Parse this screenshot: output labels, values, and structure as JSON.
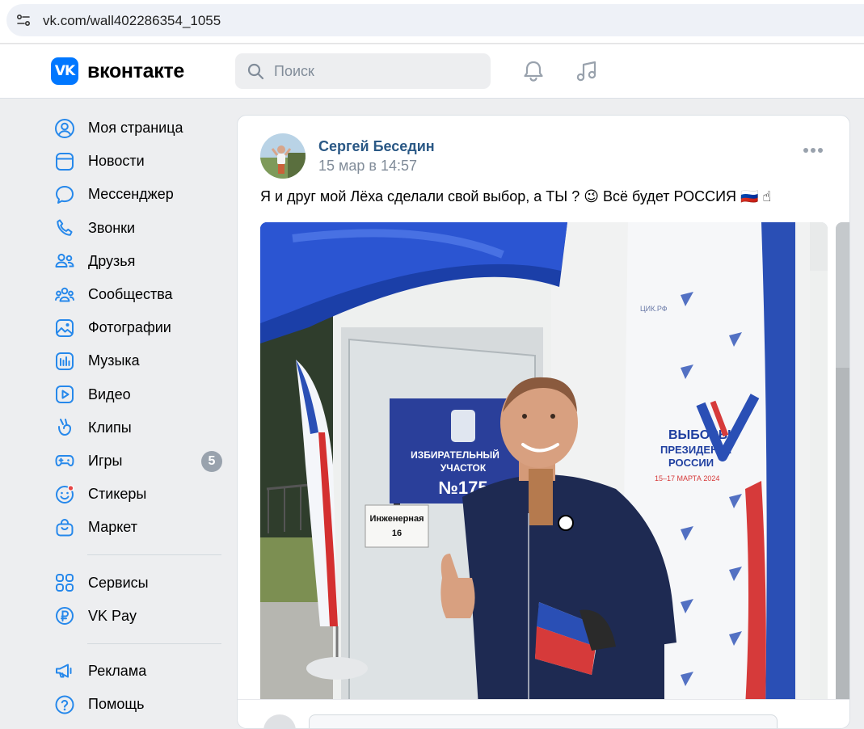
{
  "browser": {
    "url": "vk.com/wall402286354_1055"
  },
  "header": {
    "logo_mark": "VK",
    "logo_text": "вконтакте",
    "search_placeholder": "Поиск",
    "icons": [
      "bell-icon",
      "music-icon"
    ]
  },
  "sidebar": {
    "items": [
      {
        "label": "Моя страница",
        "icon": "user-circle-icon"
      },
      {
        "label": "Новости",
        "icon": "news-icon"
      },
      {
        "label": "Мессенджер",
        "icon": "message-icon"
      },
      {
        "label": "Звонки",
        "icon": "phone-icon"
      },
      {
        "label": "Друзья",
        "icon": "friends-icon"
      },
      {
        "label": "Сообщества",
        "icon": "communities-icon"
      },
      {
        "label": "Фотографии",
        "icon": "photo-icon"
      },
      {
        "label": "Музыка",
        "icon": "music-icon"
      },
      {
        "label": "Видео",
        "icon": "video-icon"
      },
      {
        "label": "Клипы",
        "icon": "clips-icon"
      },
      {
        "label": "Игры",
        "icon": "gamepad-icon",
        "badge": "5"
      },
      {
        "label": "Стикеры",
        "icon": "sticker-icon"
      },
      {
        "label": "Маркет",
        "icon": "market-bag-icon"
      }
    ],
    "items2": [
      {
        "label": "Сервисы",
        "icon": "services-grid-icon"
      },
      {
        "label": "VK Pay",
        "icon": "vkpay-icon"
      }
    ],
    "items3": [
      {
        "label": "Реклама",
        "icon": "megaphone-icon"
      },
      {
        "label": "Помощь",
        "icon": "help-icon"
      }
    ]
  },
  "post": {
    "author": "Сергей Беседин",
    "date": "15 мар в 14:57",
    "text": "Я и друг мой Лёха сделали свой выбор, а ТЫ ? 😉 Всё будет РОССИЯ 🇷🇺 ☝",
    "photo": {
      "sign_line1": "ИЗБИРАТЕЛЬНЫЙ",
      "sign_line2": "УЧАСТОК",
      "sign_number": "№175",
      "address_line1": "Инженерная",
      "address_line2": "16",
      "banner_text1": "ВЫБОРЫ",
      "banner_text2": "ПРЕЗИДЕНТА",
      "banner_text3": "РОССИИ",
      "banner_dates": "15–17 МАРТА 2024",
      "banner_small": "ЦИК.РФ"
    }
  },
  "colors": {
    "accent": "#0077ff",
    "link": "#2a5885",
    "background": "#edeef0",
    "muted": "#818c99"
  }
}
